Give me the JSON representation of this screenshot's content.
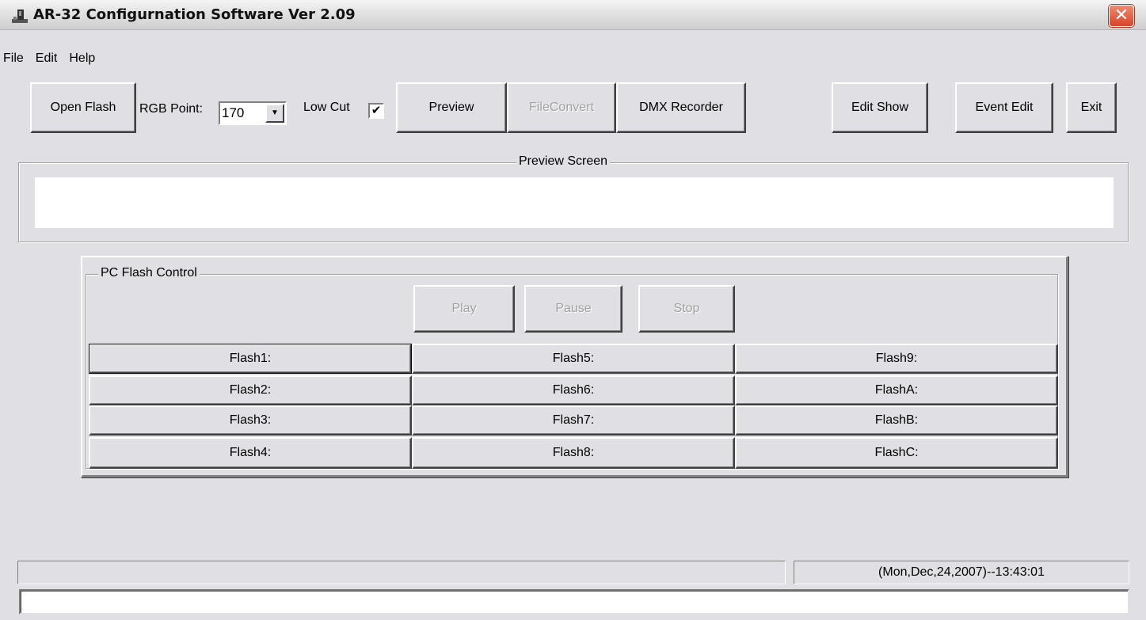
{
  "window": {
    "title": "AR-32 Configurnation Software Ver 2.09",
    "close_glyph": "✕"
  },
  "menu": [
    "File",
    "Edit",
    "Help"
  ],
  "toolbar": {
    "open_flash": "Open Flash",
    "rgb_point_label": "RGB Point:",
    "rgb_point_value": "170",
    "low_cut_label": "Low Cut",
    "low_cut_checked": "✔",
    "preview": "Preview",
    "file_convert": "FileConvert",
    "dmx_recorder": "DMX Recorder",
    "edit_show": "Edit Show",
    "event_edit": "Event Edit",
    "exit": "Exit"
  },
  "preview_screen": {
    "caption": "Preview Screen"
  },
  "pc_flash_control": {
    "caption": "PC Flash Control",
    "play": "Play",
    "pause": "Pause",
    "stop": "Stop",
    "flash_columns": [
      [
        "Flash1:",
        "Flash2:",
        "Flash3:",
        "Flash4:"
      ],
      [
        "Flash5:",
        "Flash6:",
        "Flash7:",
        "Flash8:"
      ],
      [
        "Flash9:",
        "FlashA:",
        "FlashB:",
        "FlashC:"
      ]
    ]
  },
  "status": {
    "left": "",
    "datetime": "(Mon,Dec,24,2007)--13:43:01",
    "bottom": ""
  },
  "icons": {
    "app": "app-icon",
    "close": "close-icon",
    "dropdown": "chevron-down-icon",
    "check": "check-icon"
  }
}
